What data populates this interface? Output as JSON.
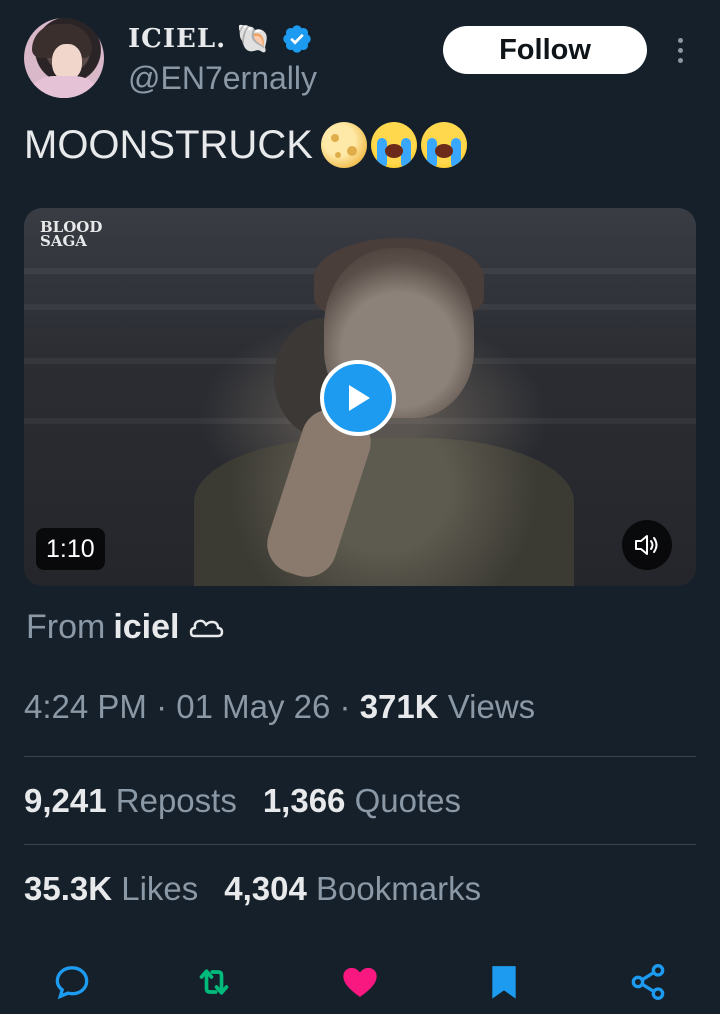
{
  "author": {
    "display_name": "ICIEL.",
    "name_emoji": "🐚",
    "handle": "@EN7ernally",
    "verified": true
  },
  "header": {
    "follow_label": "Follow"
  },
  "tweet": {
    "text": "MOONSTRUCK",
    "emojis": [
      "full-moon-face",
      "loudly-crying-face",
      "loudly-crying-face"
    ]
  },
  "video": {
    "watermark_title": "BLOOD SAGA",
    "watermark_line1": "BLOOD",
    "watermark_line2": "SAGA",
    "duration": "1:10"
  },
  "source": {
    "prefix": "From",
    "name": "iciel"
  },
  "meta": {
    "time": "4:24 PM",
    "sep1": "·",
    "date": "01 May 26",
    "sep2": "·",
    "views_count": "371K",
    "views_label": "Views"
  },
  "stats": {
    "reposts_count": "9,241",
    "reposts_label": "Reposts",
    "quotes_count": "1,366",
    "quotes_label": "Quotes",
    "likes_count": "35.3K",
    "likes_label": "Likes",
    "bookmarks_count": "4,304",
    "bookmarks_label": "Bookmarks"
  },
  "colors": {
    "background": "#15202b",
    "accent_blue": "#1d9bf0",
    "repost_green": "#00ba7c",
    "like_pink": "#f91880",
    "muted": "#8b98a5"
  },
  "actions": [
    "reply-icon",
    "repost-icon",
    "like-icon",
    "bookmark-icon",
    "share-icon"
  ]
}
